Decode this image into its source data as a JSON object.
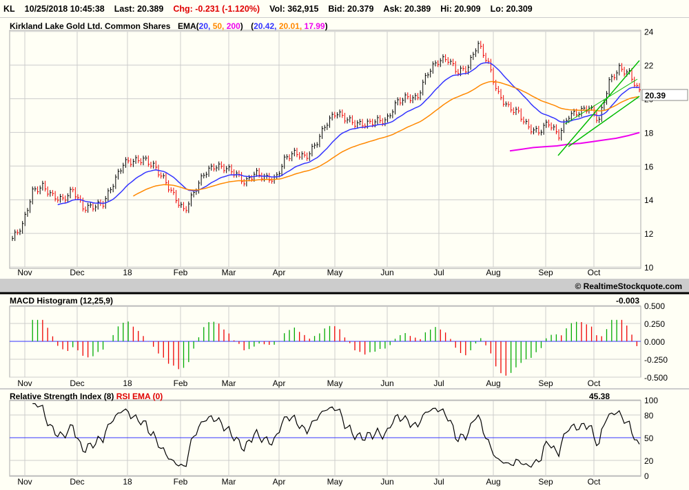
{
  "header": {
    "symbol": "KL",
    "datetime": "10/25/2018 10:45:38",
    "last": "Last: 20.389",
    "chg": "Chg: -0.231 (-1.120%)",
    "vol": "Vol: 362,915",
    "bid": "Bid: 20.379",
    "ask": "Ask: 20.389",
    "hi": "Hi: 20.909",
    "lo": "Lo: 20.309"
  },
  "price_panel": {
    "title": "Kirkland Lake Gold Ltd. Common Shares",
    "ema_label": "EMA(",
    "ema_periods": [
      "20,",
      "50,",
      "200"
    ],
    "ema_close": ")",
    "ema_values": [
      "20.42,",
      "20.01,",
      "17.99"
    ],
    "paren_open": "(",
    "paren_close": ")",
    "last_box": "20.39"
  },
  "copyright": "© RealtimeStockquote.com",
  "macd_panel": {
    "title": "MACD Histogram (12,25,9)",
    "value": "-0.003"
  },
  "rsi_panel": {
    "title": "Relative Strength Index (8)",
    "rsi_ema": "RSI EMA (0)",
    "value": "45.38"
  },
  "colors": {
    "ema20": "#3333ff",
    "ema50": "#ff8800",
    "ema200": "#ee00ee",
    "up": "#00aa00",
    "down": "#ee0000",
    "channel": "#00bb00"
  },
  "chart_data": {
    "type": "line",
    "months": [
      "Nov",
      "Dec",
      "18",
      "Feb",
      "Mar",
      "Apr",
      "May",
      "Jun",
      "Jul",
      "Aug",
      "Sep",
      "Oct"
    ],
    "price_ticks": [
      10,
      12,
      14,
      16,
      18,
      20,
      22,
      24
    ],
    "price_ylim": [
      10,
      24
    ],
    "close": [
      11.7,
      12.5,
      14.5,
      14.8,
      14.2,
      14.0,
      14.6,
      13.5,
      13.6,
      13.8,
      15.0,
      16.2,
      16.3,
      16.4,
      16.0,
      15.2,
      14.2,
      13.3,
      14.5,
      15.6,
      16.0,
      15.9,
      15.6,
      15.0,
      15.6,
      15.3,
      15.2,
      16.5,
      16.8,
      16.5,
      17.3,
      18.5,
      19.2,
      18.8,
      18.5,
      18.5,
      18.7,
      18.7,
      19.8,
      20.1,
      20.0,
      21.5,
      22.2,
      22.4,
      21.6,
      21.8,
      23.3,
      22.2,
      20.3,
      19.5,
      19.2,
      18.3,
      18.0,
      18.6,
      17.8,
      19.0,
      19.2,
      19.5,
      18.7,
      21.0,
      21.8,
      21.5,
      20.4
    ],
    "ema200_visible": [
      16.9,
      17.0,
      17.1,
      17.15,
      17.2,
      17.3,
      17.35,
      17.45,
      17.55,
      17.65,
      17.8,
      17.99
    ],
    "macd_ticks": [
      "0.500",
      "0.250",
      "0.000",
      "-0.250",
      "-0.500"
    ],
    "macd_ylim": [
      -0.5,
      0.5
    ],
    "rsi_ticks": [
      100,
      80,
      50,
      20,
      0
    ],
    "rsi_ylim": [
      0,
      100
    ]
  }
}
